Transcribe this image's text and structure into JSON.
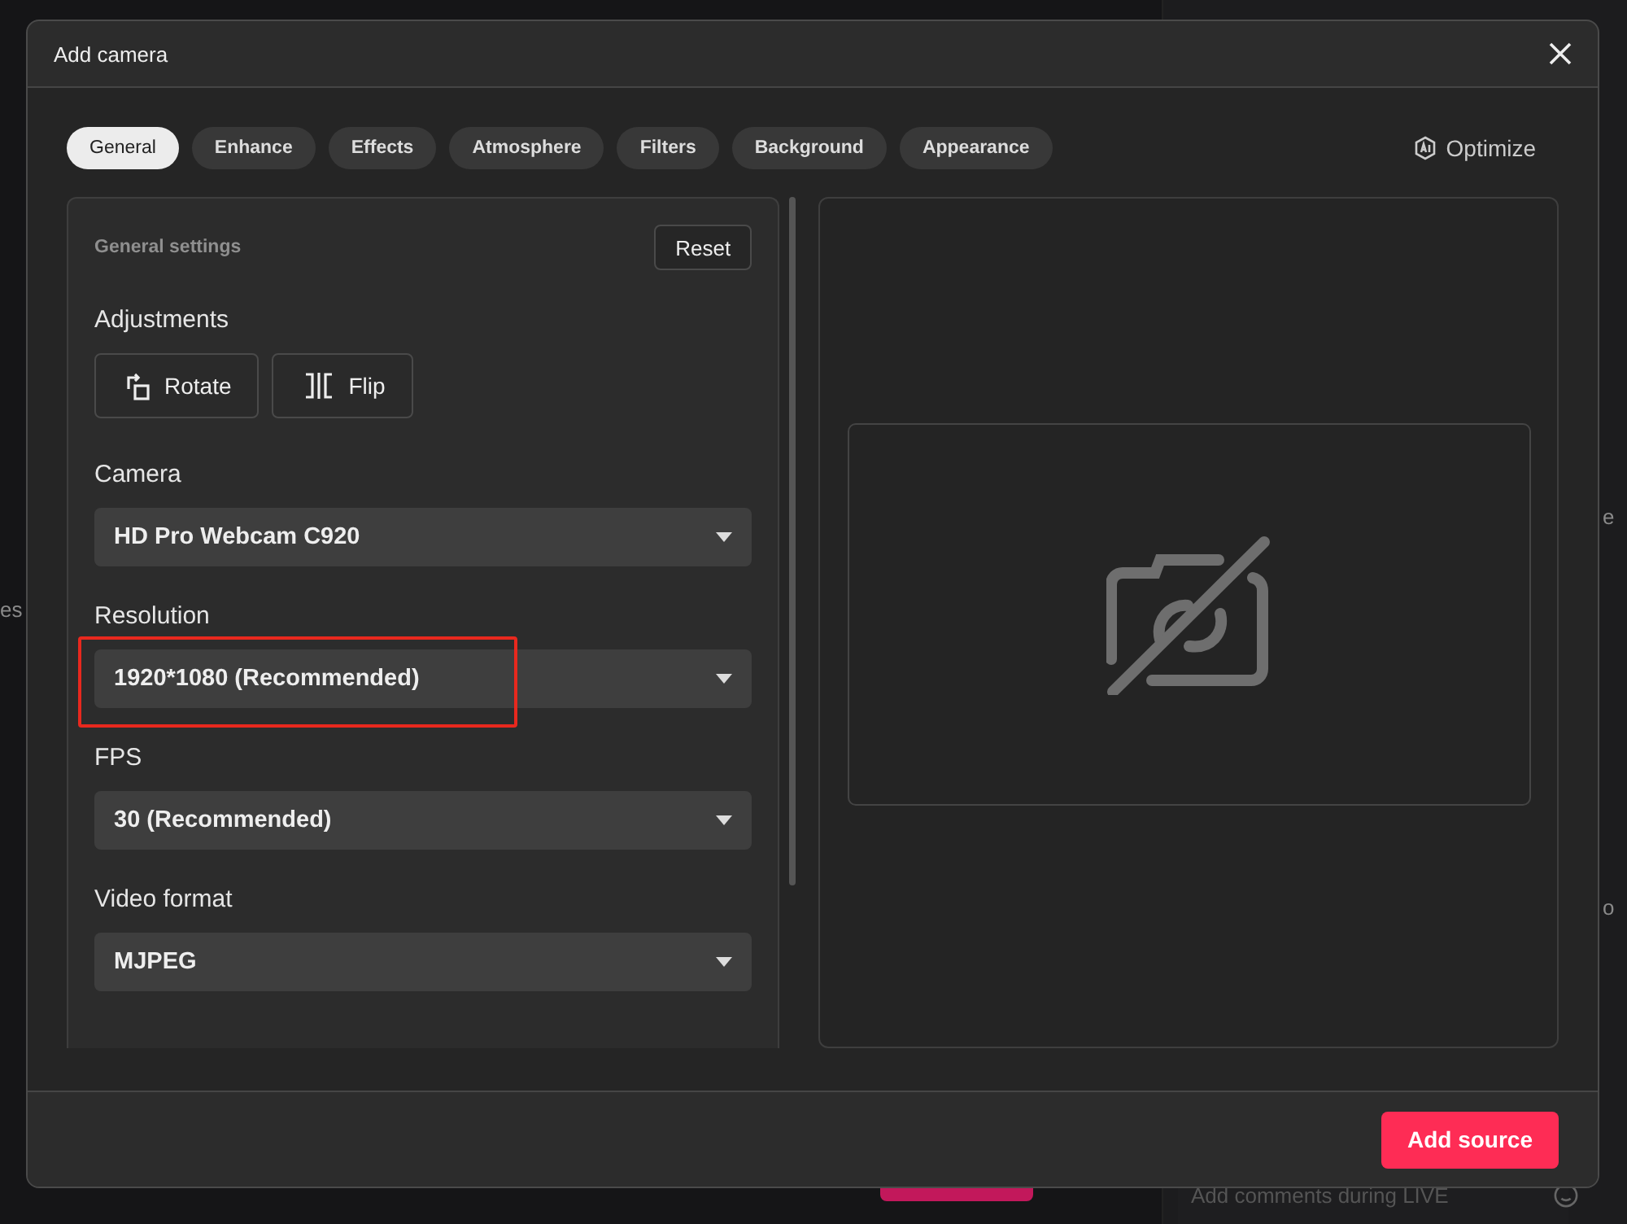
{
  "background": {
    "left_fragment": "es",
    "right_fragments": [
      "e",
      "o"
    ],
    "comment_placeholder": "Add comments during LIVE"
  },
  "dialog": {
    "title": "Add camera",
    "tabs": [
      {
        "label": "General",
        "selected": true
      },
      {
        "label": "Enhance",
        "selected": false
      },
      {
        "label": "Effects",
        "selected": false
      },
      {
        "label": "Atmosphere",
        "selected": false
      },
      {
        "label": "Filters",
        "selected": false
      },
      {
        "label": "Background",
        "selected": false
      },
      {
        "label": "Appearance",
        "selected": false
      }
    ],
    "optimize": "Optimize",
    "settings": {
      "title": "General settings",
      "reset": "Reset",
      "adjustments": {
        "label": "Adjustments",
        "buttons": [
          {
            "kind": "rotate",
            "label": "Rotate"
          },
          {
            "kind": "flip",
            "label": "Flip"
          }
        ]
      },
      "fields": [
        {
          "label": "Camera",
          "value": "HD Pro Webcam C920",
          "highlighted": false
        },
        {
          "label": "Resolution",
          "value": "1920*1080 (Recommended)",
          "highlighted": true
        },
        {
          "label": "FPS",
          "value": "30 (Recommended)",
          "highlighted": false
        },
        {
          "label": "Video format",
          "value": "MJPEG",
          "highlighted": false
        }
      ]
    },
    "primary_button": "Add source"
  }
}
